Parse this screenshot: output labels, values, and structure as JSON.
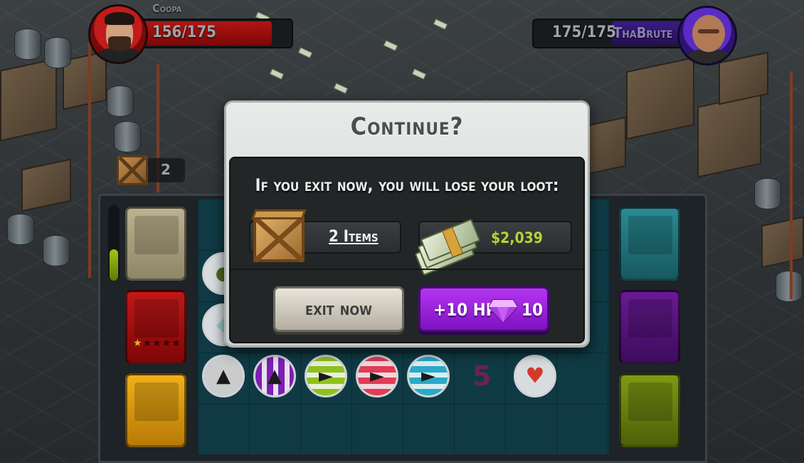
{
  "players": {
    "left": {
      "name": "Coopa",
      "hp": "156/175",
      "hp_fraction": 0.89,
      "color": "#c21c1c"
    },
    "right": {
      "name": "ThaBrute",
      "hp": "175/175",
      "hp_fraction": 1.0,
      "color": "#5b2bc4"
    }
  },
  "crate_badge": {
    "count": "2"
  },
  "board": {
    "meter_fraction": 0.4,
    "card_stars_lit": 1,
    "card_stars_total": 5,
    "tile_count": "5"
  },
  "modal": {
    "title": "Continue?",
    "warning": "If you exit now, you will lose your loot:",
    "loot_items_label": "2 Items",
    "loot_cash_label": "$2,039",
    "exit_button_label": "exit now",
    "hp_button_label": "+10 HP",
    "hp_button_cost": "10"
  },
  "colors": {
    "cash_green": "#b9d233",
    "hp_button": "#9a22db",
    "exit_button": "#d8d3c6"
  },
  "icons": {
    "gem": "purple-gem-icon",
    "crate": "crate-icon",
    "cash": "cash-stack-icon",
    "heart": "heart-icon"
  }
}
